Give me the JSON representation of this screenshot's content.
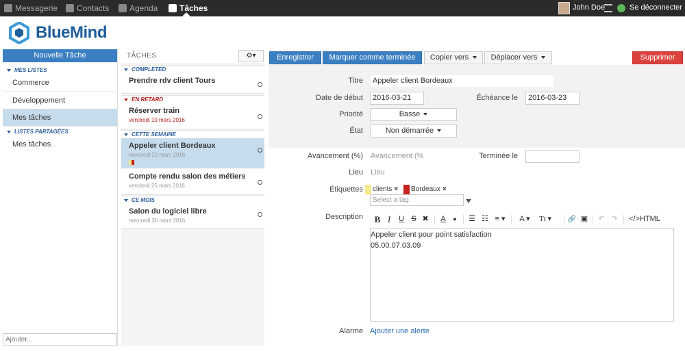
{
  "nav": {
    "items": [
      {
        "label": "Messagerie",
        "icon": "paper-plane-icon"
      },
      {
        "label": "Contacts",
        "icon": "user-icon"
      },
      {
        "label": "Agenda",
        "icon": "calendar-icon"
      },
      {
        "label": "Tâches",
        "icon": "task-icon"
      }
    ],
    "user_name": "John Doe",
    "logout_label": "Se déconnecter"
  },
  "brand": {
    "name": "BlueMind",
    "color": "#1e5e9c"
  },
  "sidebar": {
    "new_task_label": "Nouvelle Tâche",
    "section_my_lists": "MES LISTES",
    "my_lists": [
      "Commerce",
      "Développement",
      "Mes tâches"
    ],
    "section_shared": "LISTES PARTAGÉES",
    "shared_lists": [
      "Mes tâches"
    ],
    "add_placeholder": "Ajouter..."
  },
  "tasklist": {
    "title": "TÂCHES",
    "groups": [
      {
        "label": "COMPLETED",
        "tasks": [
          {
            "title": "Prendre rdv client Tours",
            "date": ""
          }
        ]
      },
      {
        "label": "EN RETARD",
        "tasks": [
          {
            "title": "Réserver train",
            "date": "vendredi 10 mars 2016"
          }
        ]
      },
      {
        "label": "CETTE SEMAINE",
        "tasks": [
          {
            "title": "Appeler client Bordeaux",
            "date": "mercredi 23 mars 2016"
          },
          {
            "title": "Compte rendu salon des métiers",
            "date": "vendredi 25 mars 2016"
          }
        ]
      },
      {
        "label": "CE MOIS",
        "tasks": [
          {
            "title": "Salon du logiciel libre",
            "date": "mercredi 30 mars 2016"
          }
        ]
      }
    ]
  },
  "toolbar": {
    "save": "Enregistrer",
    "mark_done": "Marquer comme terminée",
    "copy_to": "Copier vers",
    "move_to": "Déplacer vers",
    "delete": "Supprimer"
  },
  "form": {
    "title_label": "Titre",
    "title_value": "Appeler client Bordeaux",
    "start_label": "Date de début",
    "start_value": "2016-03-21",
    "due_label": "Échéance le",
    "due_value": "2016-03-23",
    "priority_label": "Priorité",
    "priority_value": "Basse",
    "status_label": "État",
    "status_value": "Non démarrée",
    "progress_label": "Avancement (%)",
    "progress_placeholder": "Avancement (%",
    "done_label": "Terminée le",
    "done_value": "",
    "place_label": "Lieu",
    "place_placeholder": "Lieu",
    "tags_label": "Étiquettes",
    "tags": [
      {
        "label": "clients",
        "color": "#f5e98c"
      },
      {
        "label": "Bordeaux",
        "color": "#c9231e"
      }
    ],
    "tag_placeholder": "Select a tag",
    "description_label": "Description",
    "description_lines": [
      "Appeler client pour point satisfaction",
      "05.00.07.03.09"
    ],
    "alarms_label": "Alarme",
    "add_alarm": "Ajouter une alerte"
  },
  "rte": {
    "bold": "B",
    "italic": "I",
    "underline": "U",
    "strike": "S",
    "clear": "✖",
    "font_color": "A",
    "highlight": "●",
    "ul": "☰",
    "ol": "☷",
    "align": "≡",
    "font": "A",
    "size": "Tt",
    "link": "🔗",
    "image": "▣",
    "undo": "↶",
    "redo": "↷",
    "html": "</>HTML"
  }
}
